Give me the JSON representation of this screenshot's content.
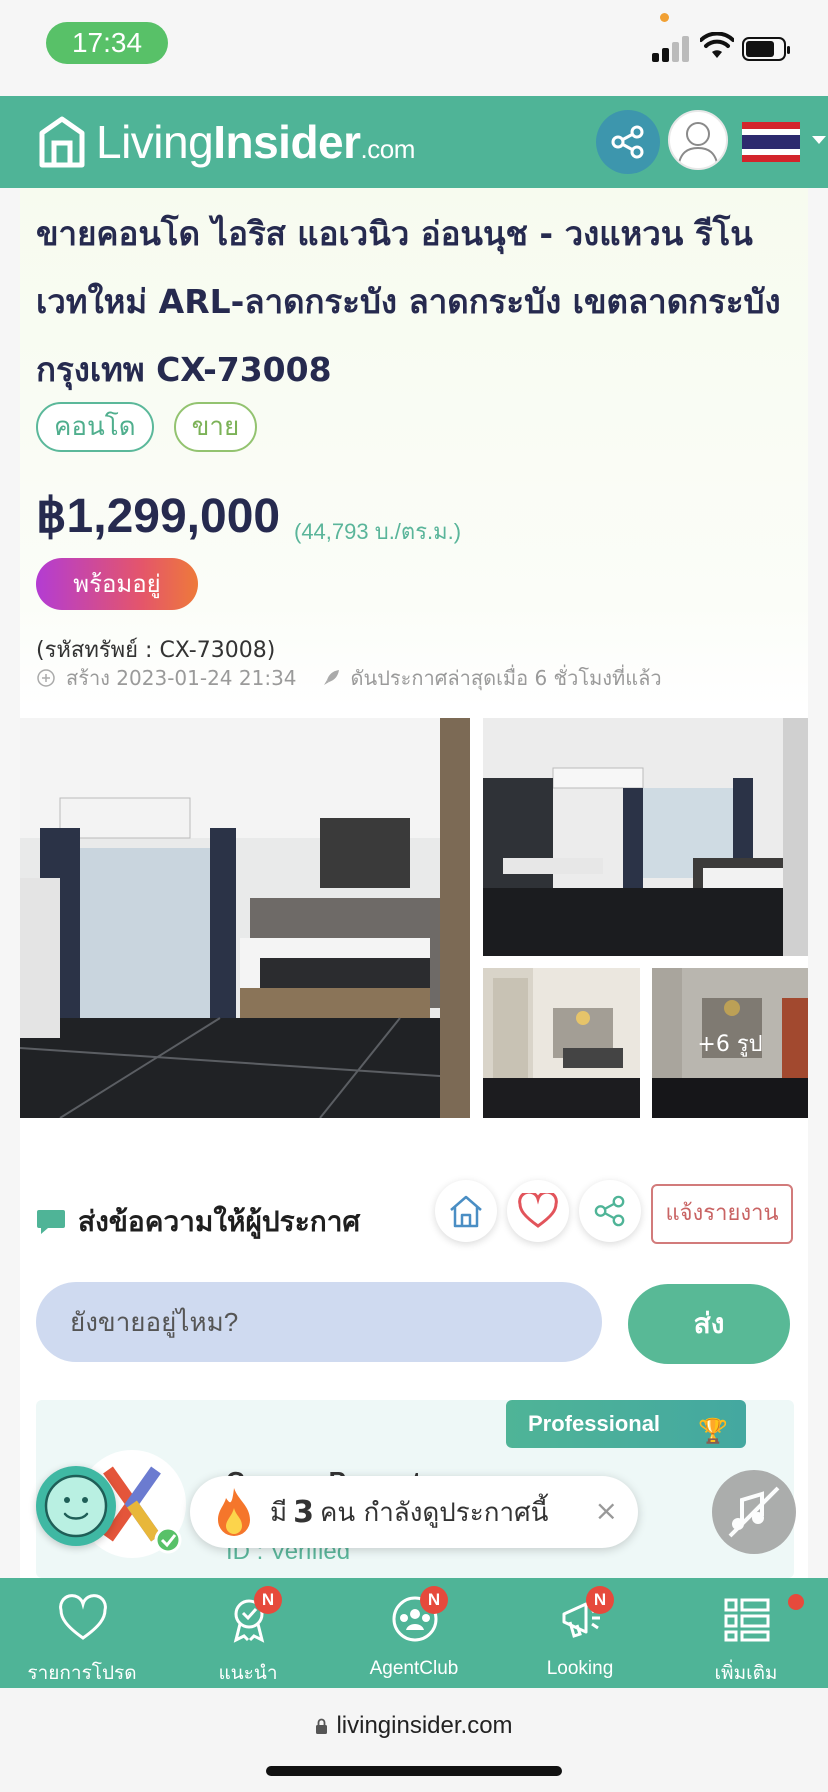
{
  "status_bar": {
    "time": "17:34"
  },
  "header": {
    "logo": {
      "living": "Living",
      "insider": "Insider",
      "com": ".com"
    }
  },
  "listing": {
    "title": "ขายคอนโด ไอริส แอเวนิว อ่อนนุช - วงแหวน รีโนเวทใหม่ ARL-ลาดกระบัง ลาดกระบัง เขตลาดกระบัง กรุงเทพ CX-73008",
    "tags": [
      "คอนโด",
      "ขาย"
    ],
    "price": "฿1,299,000",
    "price_per_sqm": "(44,793 บ./ตร.ม.)",
    "status_badge": "พร้อมอยู่",
    "property_code": "(รหัสทรัพย์ : CX-73008)",
    "created": "สร้าง 2023-01-24 21:34",
    "boosted": "ดันประกาศล่าสุดเมื่อ 6 ชั่วโมงที่แล้ว",
    "more_photos": "+6 รูป"
  },
  "contact": {
    "title": "ส่งข้อความให้ผู้ประกาศ",
    "report_label": "แจ้งรายงาน",
    "message_value": "ยังขายอยู่ไหม?",
    "send_label": "ส่ง"
  },
  "agent": {
    "badge": "Professional",
    "name": "Connex Property",
    "id_text": "ID : Verified"
  },
  "viewers": {
    "prefix": "มี",
    "count": "3",
    "suffix": "คน กำลังดูประกาศนี้",
    "close": "×"
  },
  "bottom_nav": [
    {
      "label": "รายการโปรด",
      "badge": ""
    },
    {
      "label": "แนะนำ",
      "badge": "N"
    },
    {
      "label": "AgentClub",
      "badge": "N"
    },
    {
      "label": "Looking",
      "badge": "N"
    },
    {
      "label": "เพิ่มเติม",
      "badge": ""
    }
  ],
  "browser": {
    "url": "livinginsider.com"
  },
  "colors": {
    "brand_green": "#4fb497",
    "share_blue": "#3d96ad",
    "ready_gradient_start": "#b33cd3",
    "ready_gradient_end": "#ee7a3a",
    "badge_red": "#e64a3c",
    "report_red": "#c96464"
  },
  "icons": [
    "logo-house-icon",
    "share-icon",
    "avatar-icon",
    "thailand-flag-icon",
    "plus-circle-icon",
    "rocket-icon",
    "chat-bubble-icon",
    "home-icon",
    "heart-icon",
    "share-icon",
    "trophy-icon",
    "fire-icon",
    "mute-icon",
    "heart-icon",
    "award-icon",
    "agent-club-icon",
    "megaphone-icon",
    "grid-list-icon",
    "lock-icon"
  ]
}
